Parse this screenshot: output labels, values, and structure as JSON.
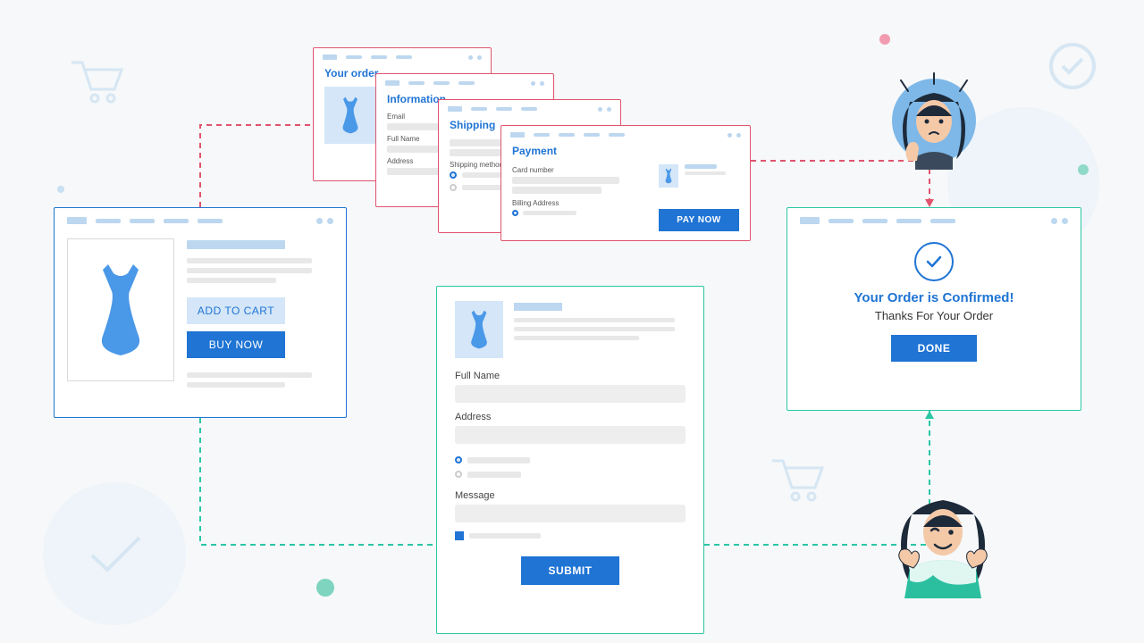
{
  "product": {
    "add_to_cart": "ADD TO CART",
    "buy_now": "BUY NOW"
  },
  "cascade": {
    "order": {
      "title": "Your order"
    },
    "info": {
      "title": "Information",
      "email": "Email",
      "full_name": "Full Name",
      "address": "Address"
    },
    "shipping": {
      "title": "Shipping",
      "method": "Shipping method"
    },
    "payment": {
      "title": "Payment",
      "card": "Card number",
      "billing": "Billing Address",
      "pay_now": "PAY NOW"
    }
  },
  "checkout": {
    "full_name": "Full Name",
    "address": "Address",
    "message": "Message",
    "submit": "SUBMIT"
  },
  "confirm": {
    "title": "Your Order is Confirmed!",
    "subtitle": "Thanks For Your Order",
    "done": "DONE"
  }
}
